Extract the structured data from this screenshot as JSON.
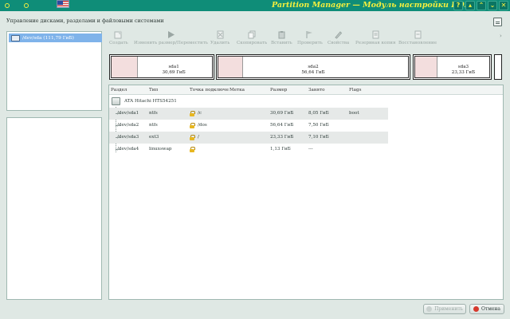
{
  "window": {
    "title": "Partition Manager — Модуль настройки KDE",
    "heading": "Управление дисками, разделами и файловыми системами"
  },
  "devices": [
    {
      "label": "/dev/sda (111,79 ГиБ)"
    }
  ],
  "toolbar": {
    "create": "Создать",
    "resize": "Изменить размер/Переместить",
    "delete": "Удалить",
    "copy": "Скопировать",
    "paste": "Вставить",
    "check": "Проверить",
    "properties": "Свойства",
    "backup": "Резервная копия",
    "restore": "Восстановление"
  },
  "partition_map": [
    {
      "name": "sda1",
      "size": "30,69 ГиБ"
    },
    {
      "name": "sda2",
      "size": "56,64 ГиБ"
    },
    {
      "name": "sda3",
      "size": "23,33 ГиБ"
    }
  ],
  "table": {
    "headers": {
      "partition": "Раздел",
      "type": "Тип",
      "mount_point": "Точка подключе",
      "label": "Метка",
      "size": "Размер",
      "used": "Занято",
      "flags": "Flags"
    },
    "disk_name": "ATA Hitachi HTS54251",
    "rows": [
      {
        "partition": "/dev/sda1",
        "type": "ntfs",
        "mount": "/c",
        "label": "",
        "size": "30,69 ГиБ",
        "used": "8,05 ГиБ",
        "flags": "boot"
      },
      {
        "partition": "/dev/sda2",
        "type": "ntfs",
        "mount": "/dos",
        "label": "",
        "size": "56,64 ГиБ",
        "used": "7,50 ГиБ",
        "flags": ""
      },
      {
        "partition": "/dev/sda3",
        "type": "ext3",
        "mount": "/",
        "label": "",
        "size": "23,33 ГиБ",
        "used": "7,10 ГиБ",
        "flags": ""
      },
      {
        "partition": "/dev/sda4",
        "type": "linuxswap",
        "mount": "",
        "label": "",
        "size": "1,13 ГиБ",
        "used": "---",
        "flags": ""
      }
    ]
  },
  "buttons": {
    "apply": "Применить",
    "cancel": "Отмена"
  },
  "colors": {
    "titlebar": "#0f8d78",
    "title_text": "#f4ef3e",
    "selection": "#7fb3ea",
    "used_space": "#f3dede",
    "cancel_icon": "#d63a2e"
  }
}
